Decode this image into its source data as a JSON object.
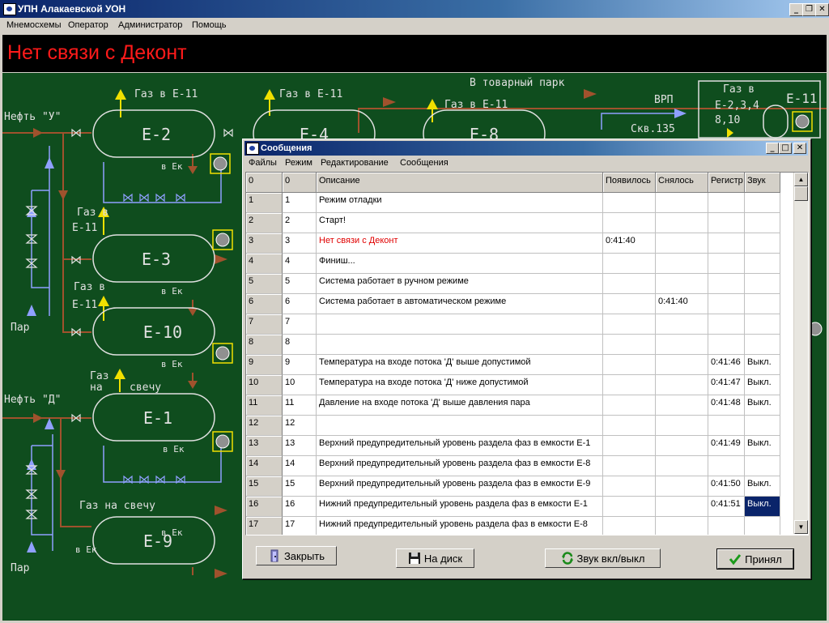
{
  "app": {
    "title": "УПН Алакаевской УОН",
    "menu": [
      "Мнемосхемы",
      "Оператор",
      "Администратор",
      "Помощь"
    ]
  },
  "banner": {
    "text": "Нет связи с Деконт",
    "color": "#ff1a1a"
  },
  "mimic": {
    "labels": {
      "gas_e11_a": "Газ в Е-11",
      "gas_e11_b": "Газ в Е-11",
      "gas_e11_c": "Газ в Е-11",
      "to_park": "В товарный парк",
      "vrp": "ВРП",
      "skv": "Скв.135",
      "gas_multi_1": "Газ в",
      "gas_multi_2": "Е-2,3,4",
      "gas_multi_3": "8,10",
      "e11_right": "Е-11",
      "oil_u": "Нефть \"У\"",
      "oil_d": "Нефть \"Д\"",
      "par_1": "Пар",
      "par_2": "Пар",
      "gas_v_1": "Газ в",
      "gas_v_e11_1": "Е-11",
      "gas_v_2": "Газ в",
      "gas_v_e11_2": "Е-11",
      "gas_na": "Газ",
      "na": "на",
      "svechu": "свечу",
      "gas_na_svechu": "Газ на свечу",
      "vek_1": "в Ек",
      "vek_2": "в Ек",
      "vek_3": "в Ек",
      "vek_4": "в Ек",
      "vek_5": "в Ек",
      "vek_6": "в Ек"
    },
    "vessels": [
      "Е-2",
      "Е-4",
      "Е-8",
      "Е-3",
      "Е-10",
      "Е-1",
      "Е-9"
    ],
    "colors": {
      "background": "#0f4d1e",
      "oil": "#a0522d",
      "gas": "#f0e000",
      "water": "#8fa0ff",
      "line": "#e0e0e0"
    }
  },
  "dialog": {
    "title": "Сообщения",
    "menu": [
      "Файлы",
      "Режим",
      "Редактирование",
      "Сообщения"
    ],
    "columns": [
      "0",
      "0",
      "Описание",
      "Появилось",
      "Снялось",
      "Регистр",
      "Звук"
    ],
    "rows": [
      {
        "n": "1",
        "id": "1",
        "desc": "Режим отладки",
        "appeared": "",
        "cleared": "",
        "reg": "",
        "sound": ""
      },
      {
        "n": "2",
        "id": "2",
        "desc": "Старт!",
        "appeared": "",
        "cleared": "",
        "reg": "",
        "sound": ""
      },
      {
        "n": "3",
        "id": "3",
        "desc": "Нет связи с Деконт",
        "appeared": "0:41:40",
        "cleared": "",
        "reg": "",
        "sound": "",
        "highlight": "red"
      },
      {
        "n": "4",
        "id": "4",
        "desc": "Финиш...",
        "appeared": "",
        "cleared": "",
        "reg": "",
        "sound": ""
      },
      {
        "n": "5",
        "id": "5",
        "desc": "Система работает в ручном режиме",
        "appeared": "",
        "cleared": "",
        "reg": "",
        "sound": ""
      },
      {
        "n": "6",
        "id": "6",
        "desc": "Система работает в автоматическом режиме",
        "appeared": "",
        "cleared": "0:41:40",
        "reg": "",
        "sound": ""
      },
      {
        "n": "7",
        "id": "7",
        "desc": "",
        "appeared": "",
        "cleared": "",
        "reg": "",
        "sound": ""
      },
      {
        "n": "8",
        "id": "8",
        "desc": "",
        "appeared": "",
        "cleared": "",
        "reg": "",
        "sound": ""
      },
      {
        "n": "9",
        "id": "9",
        "desc": "Температура на входе потока 'Д' выше допустимой",
        "appeared": "",
        "cleared": "",
        "reg": "0:41:46",
        "sound": "Выкл."
      },
      {
        "n": "10",
        "id": "10",
        "desc": "Температура на входе потока 'Д' ниже допустимой",
        "appeared": "",
        "cleared": "",
        "reg": "0:41:47",
        "sound": "Выкл."
      },
      {
        "n": "11",
        "id": "11",
        "desc": "Давление на входе потока 'Д' выше давления пара",
        "appeared": "",
        "cleared": "",
        "reg": "0:41:48",
        "sound": "Выкл."
      },
      {
        "n": "12",
        "id": "12",
        "desc": "",
        "appeared": "",
        "cleared": "",
        "reg": "",
        "sound": ""
      },
      {
        "n": "13",
        "id": "13",
        "desc": "Верхний предупредительный уровень раздела фаз в емкости Е-1",
        "appeared": "",
        "cleared": "",
        "reg": "0:41:49",
        "sound": "Выкл."
      },
      {
        "n": "14",
        "id": "14",
        "desc": "Верхний предупредительный уровень раздела фаз в емкости Е-8",
        "appeared": "",
        "cleared": "",
        "reg": "",
        "sound": ""
      },
      {
        "n": "15",
        "id": "15",
        "desc": "Верхний предупредительный уровень раздела фаз в емкости Е-9",
        "appeared": "",
        "cleared": "",
        "reg": "0:41:50",
        "sound": "Выкл."
      },
      {
        "n": "16",
        "id": "16",
        "desc": "Нижний предупредительный уровень раздела фаз в емкости Е-1",
        "appeared": "",
        "cleared": "",
        "reg": "0:41:51",
        "sound": "Выкл.",
        "selected_cell": "sound"
      },
      {
        "n": "17",
        "id": "17",
        "desc": "Нижний предупредительный уровень раздела фаз в емкости Е-8",
        "appeared": "",
        "cleared": "",
        "reg": "",
        "sound": ""
      }
    ],
    "buttons": {
      "close": "Закрыть",
      "save": "На диск",
      "sound": "Звук вкл/выкл",
      "accept": "Принял"
    }
  }
}
